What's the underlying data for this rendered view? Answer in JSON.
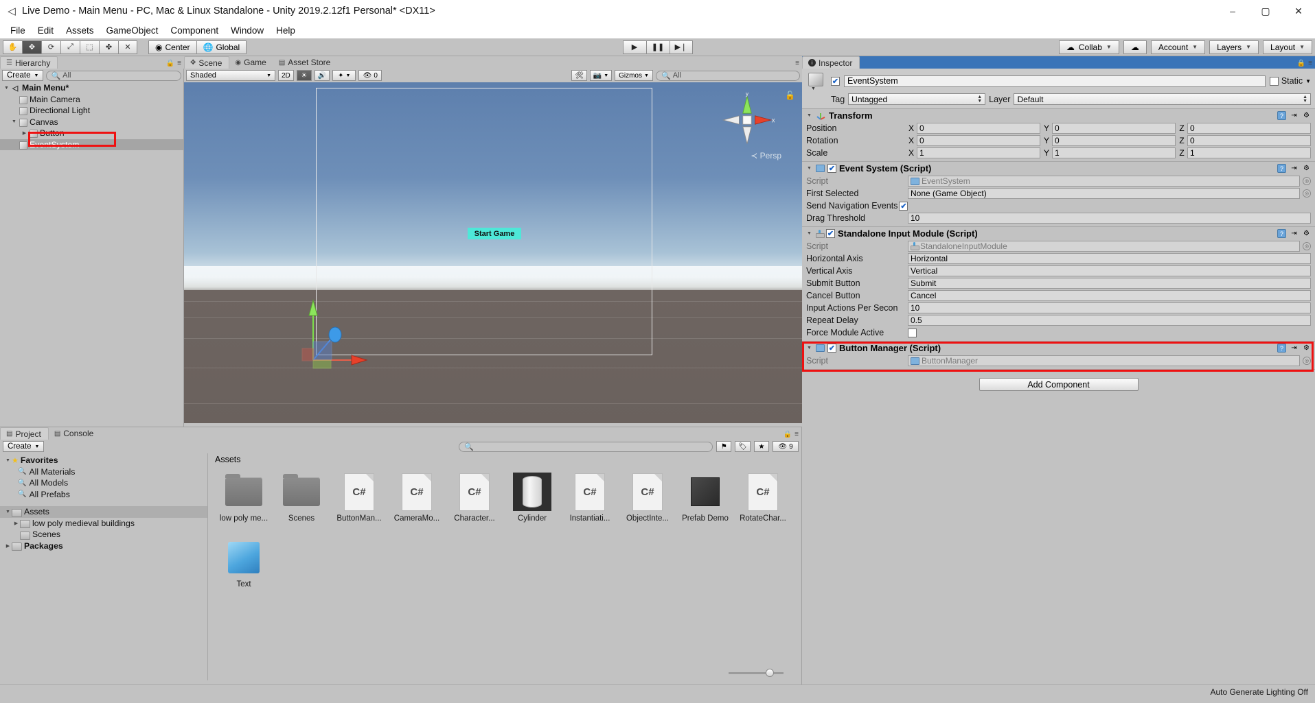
{
  "window": {
    "title": "Live Demo - Main Menu - PC, Mac & Linux Standalone - Unity 2019.2.12f1 Personal* <DX11>",
    "app_icon": "unity-icon",
    "minimize": "–",
    "maximize": "▢",
    "close": "✕"
  },
  "menubar": {
    "items": [
      "File",
      "Edit",
      "Assets",
      "GameObject",
      "Component",
      "Window",
      "Help"
    ]
  },
  "toolbar": {
    "tools": [
      "hand-tool",
      "move-tool",
      "rotate-tool",
      "scale-tool",
      "rect-tool",
      "transform-tool",
      "custom-tool"
    ],
    "pivot_mode": "Center",
    "pivot_rotation": "Global",
    "play": "▶",
    "pause": "❚❚",
    "step": "▶❘",
    "collab": "Collab",
    "cloud": "☁",
    "account": "Account",
    "layers": "Layers",
    "layout": "Layout"
  },
  "hierarchy": {
    "tab": "Hierarchy",
    "tab_icon": "hierarchy-icon",
    "create_label": "Create",
    "search_placeholder": "All",
    "items": [
      {
        "label": "Main Menu*",
        "depth": 0,
        "twirl": "▼",
        "icon": "unity-scene-icon",
        "selected": false,
        "root": true
      },
      {
        "label": "Main Camera",
        "depth": 1,
        "twirl": "",
        "icon": "gameobject-icon",
        "selected": false,
        "root": false
      },
      {
        "label": "Directional Light",
        "depth": 1,
        "twirl": "",
        "icon": "gameobject-icon",
        "selected": false,
        "root": false
      },
      {
        "label": "Canvas",
        "depth": 1,
        "twirl": "▼",
        "icon": "gameobject-icon",
        "selected": false,
        "root": false
      },
      {
        "label": "Button",
        "depth": 2,
        "twirl": "▶",
        "icon": "gameobject-icon",
        "selected": false,
        "root": false
      },
      {
        "label": "EventSystem",
        "depth": 1,
        "twirl": "",
        "icon": "gameobject-icon",
        "selected": true,
        "root": false
      }
    ]
  },
  "scene": {
    "tabs": [
      {
        "label": "Scene",
        "icon": "scene-icon",
        "selected": true
      },
      {
        "label": "Game",
        "icon": "game-icon",
        "selected": false
      },
      {
        "label": "Asset Store",
        "icon": "store-icon",
        "selected": false
      }
    ],
    "shading_mode": "Shaded",
    "view_2d": "2D",
    "lighting_icon": "lightbulb-icon",
    "audio_icon": "speaker-icon",
    "fx_icon": "effects-icon",
    "gizmo_count": "0",
    "gizmos_label": "Gizmos",
    "search_placeholder": "All",
    "persp_label": "Persp",
    "axis_y": "y",
    "axis_x": "x",
    "button_label": "Start Game"
  },
  "inspector": {
    "tab": "Inspector",
    "tab_icon": "inspector-icon",
    "object_name": "EventSystem",
    "enabled": true,
    "static_label": "Static",
    "tag_label": "Tag",
    "tag_value": "Untagged",
    "layer_label": "Layer",
    "layer_value": "Default",
    "add_component": "Add Component",
    "components": [
      {
        "title": "Transform",
        "icon": "transform-icon",
        "has_checkbox": false,
        "highlighted": false,
        "rows": [
          {
            "type": "vector3",
            "name": "Position",
            "x": "0",
            "y": "0",
            "z": "0"
          },
          {
            "type": "vector3",
            "name": "Rotation",
            "x": "0",
            "y": "0",
            "z": "0"
          },
          {
            "type": "vector3",
            "name": "Scale",
            "x": "1",
            "y": "1",
            "z": "1"
          }
        ]
      },
      {
        "title": "Event System (Script)",
        "icon": "script-icon",
        "has_checkbox": true,
        "checked": true,
        "highlighted": false,
        "rows": [
          {
            "type": "objref",
            "name": "Script",
            "value": "EventSystem",
            "dim": true,
            "icon": "script-icon"
          },
          {
            "type": "objref",
            "name": "First Selected",
            "value": "None (Game Object)",
            "dim": false,
            "icon": ""
          },
          {
            "type": "checkbox",
            "name": "Send Navigation Events",
            "checked": true
          },
          {
            "type": "text",
            "name": "Drag Threshold",
            "value": "10"
          }
        ]
      },
      {
        "title": "Standalone Input Module (Script)",
        "icon": "joystick-icon",
        "has_checkbox": true,
        "checked": true,
        "highlighted": false,
        "rows": [
          {
            "type": "objref",
            "name": "Script",
            "value": "StandaloneInputModule",
            "dim": true,
            "icon": "joystick-icon"
          },
          {
            "type": "text",
            "name": "Horizontal Axis",
            "value": "Horizontal"
          },
          {
            "type": "text",
            "name": "Vertical Axis",
            "value": "Vertical"
          },
          {
            "type": "text",
            "name": "Submit Button",
            "value": "Submit"
          },
          {
            "type": "text",
            "name": "Cancel Button",
            "value": "Cancel"
          },
          {
            "type": "text",
            "name": "Input Actions Per Secon",
            "value": "10"
          },
          {
            "type": "text",
            "name": "Repeat Delay",
            "value": "0.5"
          },
          {
            "type": "checkbox",
            "name": "Force Module Active",
            "checked": false
          }
        ]
      },
      {
        "title": "Button Manager (Script)",
        "icon": "script-icon",
        "has_checkbox": true,
        "checked": true,
        "highlighted": true,
        "rows": [
          {
            "type": "objref",
            "name": "Script",
            "value": "ButtonManager",
            "dim": true,
            "icon": "script-icon"
          }
        ]
      }
    ]
  },
  "project": {
    "tabs": [
      {
        "label": "Project",
        "icon": "project-icon",
        "selected": true
      },
      {
        "label": "Console",
        "icon": "console-icon",
        "selected": false
      }
    ],
    "create_label": "Create",
    "search_placeholder": "",
    "icon_count": "9",
    "tree": [
      {
        "label": "Favorites",
        "depth": 0,
        "icon": "star-icon",
        "twirl": "▼",
        "selected": false,
        "bold": true
      },
      {
        "label": "All Materials",
        "depth": 1,
        "icon": "search-icon",
        "twirl": "",
        "selected": false,
        "bold": false
      },
      {
        "label": "All Models",
        "depth": 1,
        "icon": "search-icon",
        "twirl": "",
        "selected": false,
        "bold": false
      },
      {
        "label": "All Prefabs",
        "depth": 1,
        "icon": "search-icon",
        "twirl": "",
        "selected": false,
        "bold": false
      },
      {
        "label": "Assets",
        "depth": 0,
        "icon": "folder-icon",
        "twirl": "▼",
        "selected": true,
        "bold": false
      },
      {
        "label": "low poly medieval buildings",
        "depth": 1,
        "icon": "folder-icon",
        "twirl": "▶",
        "selected": false,
        "bold": false
      },
      {
        "label": "Scenes",
        "depth": 1,
        "icon": "folder-icon",
        "twirl": "",
        "selected": false,
        "bold": false
      },
      {
        "label": "Packages",
        "depth": 0,
        "icon": "folder-icon",
        "twirl": "▶",
        "selected": false,
        "bold": true
      }
    ],
    "breadcrumb": "Assets",
    "assets": [
      {
        "label": "low poly me...",
        "kind": "folder",
        "selected": false
      },
      {
        "label": "Scenes",
        "kind": "folder",
        "selected": false
      },
      {
        "label": "ButtonMan...",
        "kind": "csharp",
        "glyph": "C#",
        "selected": false
      },
      {
        "label": "CameraMo...",
        "kind": "csharp",
        "glyph": "C#",
        "selected": false
      },
      {
        "label": "Character...",
        "kind": "csharp",
        "glyph": "C#",
        "selected": false
      },
      {
        "label": "Cylinder",
        "kind": "cylinder",
        "selected": true
      },
      {
        "label": "Instantiati...",
        "kind": "csharp",
        "glyph": "C#",
        "selected": false
      },
      {
        "label": "ObjectInte...",
        "kind": "csharp",
        "glyph": "C#",
        "selected": false
      },
      {
        "label": "Prefab Demo",
        "kind": "cube",
        "selected": false
      },
      {
        "label": "RotateChar...",
        "kind": "csharp",
        "glyph": "C#",
        "selected": false
      },
      {
        "label": "Text",
        "kind": "text",
        "selected": false
      }
    ]
  },
  "statusbar": {
    "text": "Auto Generate Lighting Off"
  }
}
